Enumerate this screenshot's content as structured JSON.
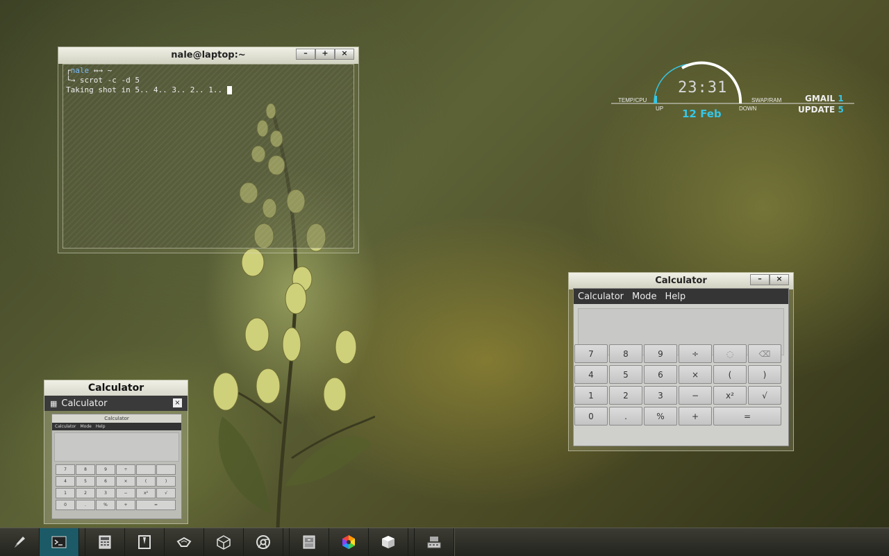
{
  "terminal": {
    "title": "nale@laptop:~",
    "prompt_user": "nale",
    "prompt_rest": " ↔→ ~",
    "command": "scrot -c -d 5",
    "output": "Taking shot in 5.. 4.. 3.. 2.. 1.. ",
    "buttons": {
      "min": "–",
      "max": "+",
      "close": "×"
    }
  },
  "conky": {
    "temp_cpu": "TEMP/CPU",
    "up": "UP",
    "time": "23:31",
    "down": "DOWN",
    "swap_ram": "SWAP/RAM",
    "date": "12 Feb",
    "gmail_label": "GMAIL",
    "gmail_count": "1",
    "update_label": "UPDATE",
    "update_count": "5",
    "accent": "#35c7e8"
  },
  "calculator": {
    "title": "Calculator",
    "buttons": {
      "min": "–",
      "close": "×"
    },
    "menu": [
      "Calculator",
      "Mode",
      "Help"
    ],
    "keys": [
      {
        "label": "7"
      },
      {
        "label": "8"
      },
      {
        "label": "9"
      },
      {
        "label": "÷"
      },
      {
        "label": "",
        "icon": "undo-icon"
      },
      {
        "label": "",
        "icon": "clear-icon"
      },
      {
        "label": "4"
      },
      {
        "label": "5"
      },
      {
        "label": "6"
      },
      {
        "label": "×"
      },
      {
        "label": "("
      },
      {
        "label": ")"
      },
      {
        "label": "1"
      },
      {
        "label": "2"
      },
      {
        "label": "3"
      },
      {
        "label": "−"
      },
      {
        "label": "x²"
      },
      {
        "label": "√"
      },
      {
        "label": "0"
      },
      {
        "label": "."
      },
      {
        "label": "%"
      },
      {
        "label": "+"
      },
      {
        "label": "=",
        "wide": true
      }
    ]
  },
  "mini_preview": {
    "title": "Calculator",
    "bar_label": "Calculator",
    "close": "×",
    "app_title": "Calculator",
    "menu": [
      "Calculator",
      "Mode",
      "Help"
    ]
  },
  "taskbar": {
    "items": [
      "pen-icon",
      "terminal-icon",
      "calculator-icon",
      "file-manager-icon",
      "network-icon",
      "cube-icon",
      "chrome-icon",
      "drawer-icon",
      "color-picker-icon",
      "box-icon",
      "keyboard-icon"
    ],
    "active": "terminal-icon"
  }
}
